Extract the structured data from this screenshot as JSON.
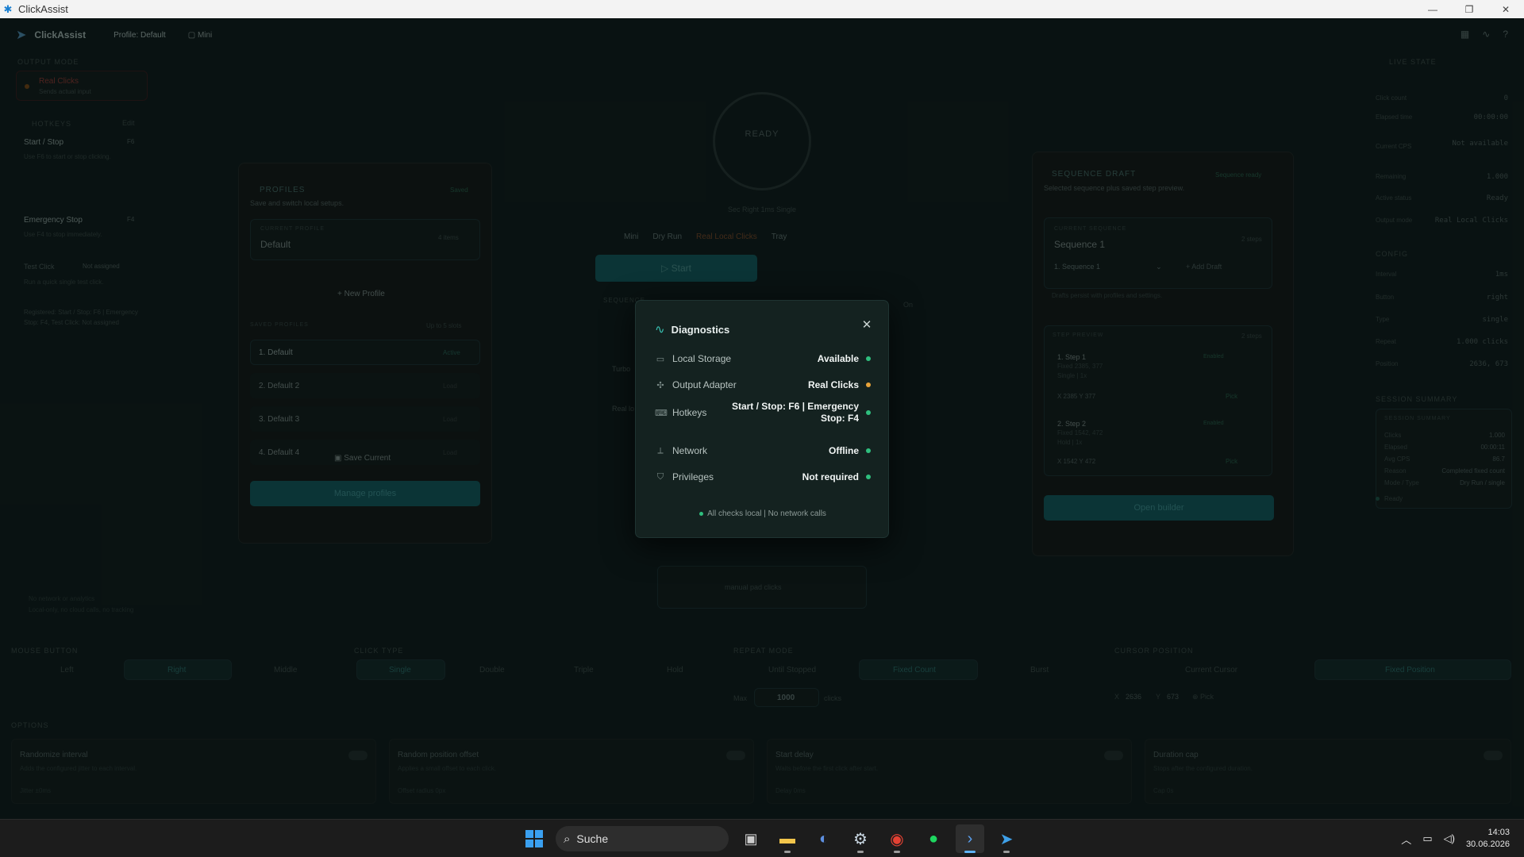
{
  "window": {
    "title": "ClickAssist"
  },
  "appbar": {
    "name": "ClickAssist",
    "profile": "Profile: Default",
    "mini": "Mini"
  },
  "left": {
    "output_mode_label": "OUTPUT MODE",
    "output_mode_value": "Real Clicks",
    "output_mode_sub": "Sends actual input",
    "hotkeys_label": "HOTKEYS",
    "hotkeys_action": "Edit",
    "hotkeys": [
      {
        "name": "Start / Stop",
        "key": "F6",
        "desc": "Use F6 to start or stop clicking."
      },
      {
        "name": "Emergency Stop",
        "key": "F4",
        "desc": "Use F4 to stop immediately."
      },
      {
        "name": "Test Click",
        "key": "Not assigned",
        "desc": "Run a quick single test click."
      }
    ],
    "registered": "Registered: Start / Stop: F6 | Emergency Stop: F4, Test Click: Not assigned",
    "footer1": "No network or analytics",
    "footer2": "Local-only, no cloud calls, no tracking"
  },
  "profiles": {
    "title": "PROFILES",
    "badge": "Saved",
    "subtitle": "Save and switch local setups.",
    "current_label": "CURRENT PROFILE",
    "current_name": "Default",
    "current_meta": "4 items",
    "new_profile": "New Profile",
    "saved_label": "SAVED PROFILES",
    "saved_meta": "Up to 5 slots",
    "items": [
      {
        "name": "1. Default",
        "tag": "Active"
      },
      {
        "name": "2. Default 2",
        "tag": "Load"
      },
      {
        "name": "3. Default 3",
        "tag": "Load"
      },
      {
        "name": "4. Default 4",
        "tag": "Load"
      }
    ],
    "save_current": "Save Current",
    "manage": "Manage profiles"
  },
  "center": {
    "ready": "READY",
    "ring_sub": "Sec  Right  1ms  Single",
    "modes": [
      "Mini",
      "Dry Run",
      "Real Local Clicks",
      "Tray"
    ],
    "start": "Start",
    "sequence_label": "SEQUENCE",
    "sequence_toggle": "On",
    "manual": "manual pad clicks",
    "rows": [
      "Turbo",
      "Real lo"
    ]
  },
  "dialog": {
    "title": "Diagnostics",
    "rows": [
      {
        "icon": "storage-icon",
        "label": "Local Storage",
        "value": "Available",
        "status": "#2fbf7e"
      },
      {
        "icon": "adapter-icon",
        "label": "Output Adapter",
        "value": "Real Clicks",
        "status": "#e8a33a"
      },
      {
        "icon": "keyboard-icon",
        "label": "Hotkeys",
        "value": "Start / Stop: F6 | Emergency Stop: F4",
        "status": "#2fbf7e"
      },
      {
        "icon": "network-off-icon",
        "label": "Network",
        "value": "Offline",
        "status": "#2fbf7e"
      },
      {
        "icon": "shield-icon",
        "label": "Privileges",
        "value": "Not required",
        "status": "#2fbf7e"
      }
    ],
    "footer": "All checks local | No network calls"
  },
  "sequence": {
    "title": "SEQUENCE DRAFT",
    "badge": "Sequence ready",
    "subtitle": "Selected sequence plus saved step preview.",
    "current_label": "CURRENT SEQUENCE",
    "current_name": "Sequence 1",
    "current_meta": "2 steps",
    "select": "1. Sequence 1",
    "add_draft": "Add Draft",
    "hint": "Drafts persist with profiles and settings.",
    "steps_label": "STEP PREVIEW",
    "steps_meta": "2 steps",
    "steps": [
      {
        "name": "1. Step 1",
        "l1": "Fixed 2385, 377",
        "l2": "Single | 1x",
        "coord": "X 2385 Y 377",
        "tag": "Enabled",
        "pick": "Pick"
      },
      {
        "name": "2. Step 2",
        "l1": "Fixed 1542, 472",
        "l2": "Hold | 1x",
        "coord": "X 1542 Y 472",
        "tag": "Enabled",
        "pick": "Pick"
      }
    ],
    "open_builder": "Open builder"
  },
  "live": {
    "title": "LIVE STATE",
    "rows": [
      {
        "k": "Click count",
        "v": "0"
      },
      {
        "k": "Elapsed time",
        "v": "00:00:00"
      },
      {
        "k": "Current CPS",
        "v": "Not available"
      },
      {
        "k": "Remaining",
        "v": "1.000"
      },
      {
        "k": "Active status",
        "v": "Ready"
      },
      {
        "k": "Output mode",
        "v": "Real Local Clicks"
      }
    ],
    "config_label": "CONFIG",
    "config": [
      {
        "k": "Interval",
        "v": "1ms"
      },
      {
        "k": "Button",
        "v": "right"
      },
      {
        "k": "Type",
        "v": "single"
      },
      {
        "k": "Repeat",
        "v": "1.000 clicks"
      },
      {
        "k": "Position",
        "v": "2636, 673"
      }
    ],
    "summary_label": "SESSION SUMMARY",
    "summary_inner": "SESSION SUMMARY",
    "summary": [
      {
        "k": "Clicks",
        "v": "1.000"
      },
      {
        "k": "Elapsed",
        "v": "00:00:11"
      },
      {
        "k": "Avg CPS",
        "v": "86.7"
      },
      {
        "k": "Reason",
        "v": "Completed fixed count"
      },
      {
        "k": "Mode / Type",
        "v": "Dry Run / single"
      }
    ],
    "status": "Ready"
  },
  "bottom": {
    "mouse_label": "MOUSE BUTTON",
    "mouse": [
      "Left",
      "Right",
      "Middle"
    ],
    "click_label": "CLICK TYPE",
    "click": [
      "Single",
      "Double",
      "Triple",
      "Hold"
    ],
    "repeat_label": "REPEAT MODE",
    "repeat": [
      "Until Stopped",
      "Fixed Count",
      "Burst"
    ],
    "max_label": "Max",
    "max_value": "1000",
    "max_unit": "clicks",
    "cursor_label": "CURSOR POSITION",
    "cursor": [
      "Current Cursor",
      "Fixed Position"
    ],
    "x_label": "X",
    "x_value": "2636",
    "y_label": "Y",
    "y_value": "673",
    "pick": "Pick",
    "options_label": "OPTIONS",
    "options": [
      {
        "name": "Randomize interval",
        "desc": "Adds the configured jitter to each interval.",
        "sub": "Jitter ±0ms"
      },
      {
        "name": "Random position offset",
        "desc": "Applies a small offset to each click.",
        "sub": "Offset radius 0px"
      },
      {
        "name": "Start delay",
        "desc": "Waits before the first click after start.",
        "sub": "Delay 0ms"
      },
      {
        "name": "Duration cap",
        "desc": "Stops after the configured duration.",
        "sub": "Cap 0s"
      }
    ]
  },
  "taskbar": {
    "search": "Suche",
    "time": "14:03",
    "date": "30.06.2026"
  }
}
